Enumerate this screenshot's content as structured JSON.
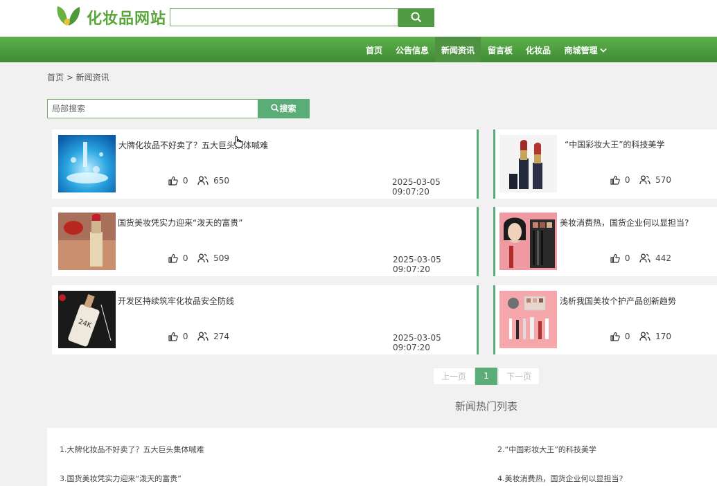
{
  "header": {
    "site_title": "化妆品网站",
    "logo": "leaf-logo",
    "search": {
      "value": "",
      "placeholder": "",
      "button_icon": "search-icon"
    }
  },
  "nav": {
    "items": [
      {
        "label": "首页"
      },
      {
        "label": "公告信息"
      },
      {
        "label": "新闻资讯",
        "active": true
      },
      {
        "label": "留言板"
      },
      {
        "label": "化妆品"
      },
      {
        "label": "商城管理",
        "icon": "chevron-down-icon"
      }
    ]
  },
  "breadcrumb": "首页 > 新闻资讯",
  "local_search": {
    "placeholder": "局部搜索",
    "button_label": "搜索"
  },
  "news": [
    {
      "title": "大牌化妆品不好卖了？五大巨头集体喊难",
      "likes": "0",
      "views": "650",
      "date": "2025-03-05 09:07:20"
    },
    {
      "title": "“中国彩妆大王”的科技美学",
      "likes": "0",
      "views": "570",
      "date": ""
    },
    {
      "title": "国货美妆凭实力迎来“泼天的富贵”",
      "likes": "0",
      "views": "509",
      "date": "2025-03-05 09:07:20"
    },
    {
      "title": "美妆消费热，国货企业何以显担当?",
      "likes": "0",
      "views": "442",
      "date": ""
    },
    {
      "title": "开发区持续筑牢化妆品安全防线",
      "likes": "0",
      "views": "274",
      "date": "2025-03-05 09:07:20"
    },
    {
      "title": "浅析我国美妆个护产品创新趋势",
      "likes": "0",
      "views": "170",
      "date": ""
    }
  ],
  "pagination": {
    "prev": "上一页",
    "current": "1",
    "next": "下一页"
  },
  "hot": {
    "title": "新闻热门列表",
    "items": [
      "1.大牌化妆品不好卖了？五大巨头集体喊难",
      "2.“中国彩妆大王”的科技美学",
      "3.国货美妆凭实力迎来“泼天的富贵”",
      "4.美妆消费热，国货企业何以显担当?"
    ]
  },
  "colors": {
    "brand_green": "#5aa53a",
    "nav_green": "#4e9141",
    "accent": "#5aad77"
  }
}
